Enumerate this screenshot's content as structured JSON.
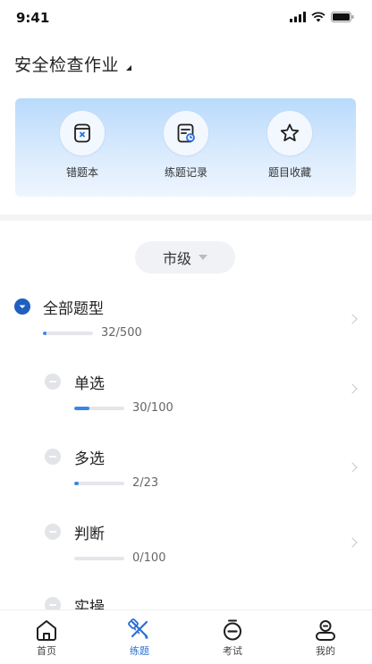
{
  "status_bar": {
    "time": "9:41"
  },
  "header": {
    "title": "安全检查作业"
  },
  "quick_actions": [
    {
      "icon": "wrong-book-icon",
      "label": "错题本"
    },
    {
      "icon": "practice-record-icon",
      "label": "练题记录"
    },
    {
      "icon": "star-icon",
      "label": "题目收藏"
    }
  ],
  "level_selector": {
    "value": "市级"
  },
  "question_types": [
    {
      "label": "全部题型",
      "count": "32/500",
      "progress": 0.064,
      "expanded": true,
      "level": 0
    },
    {
      "label": "单选",
      "count": "30/100",
      "progress": 0.3,
      "expanded": false,
      "level": 1
    },
    {
      "label": "多选",
      "count": "2/23",
      "progress": 0.087,
      "expanded": false,
      "level": 1
    },
    {
      "label": "判断",
      "count": "0/100",
      "progress": 0,
      "expanded": false,
      "level": 1
    },
    {
      "label": "实操",
      "count": "",
      "progress": 0,
      "expanded": false,
      "level": 1
    }
  ],
  "tabbar": {
    "active": "练题",
    "items": [
      {
        "icon": "home-icon",
        "label": "首页"
      },
      {
        "icon": "practice-icon",
        "label": "练题"
      },
      {
        "icon": "exam-timer-icon",
        "label": "考试"
      },
      {
        "icon": "profile-icon",
        "label": "我的"
      }
    ]
  },
  "colors": {
    "accent": "#2b6fd6",
    "progress_fill": "#3a86e8",
    "bullet_open": "#1e5fbf",
    "card_gradient_top": "#b9dafc"
  }
}
